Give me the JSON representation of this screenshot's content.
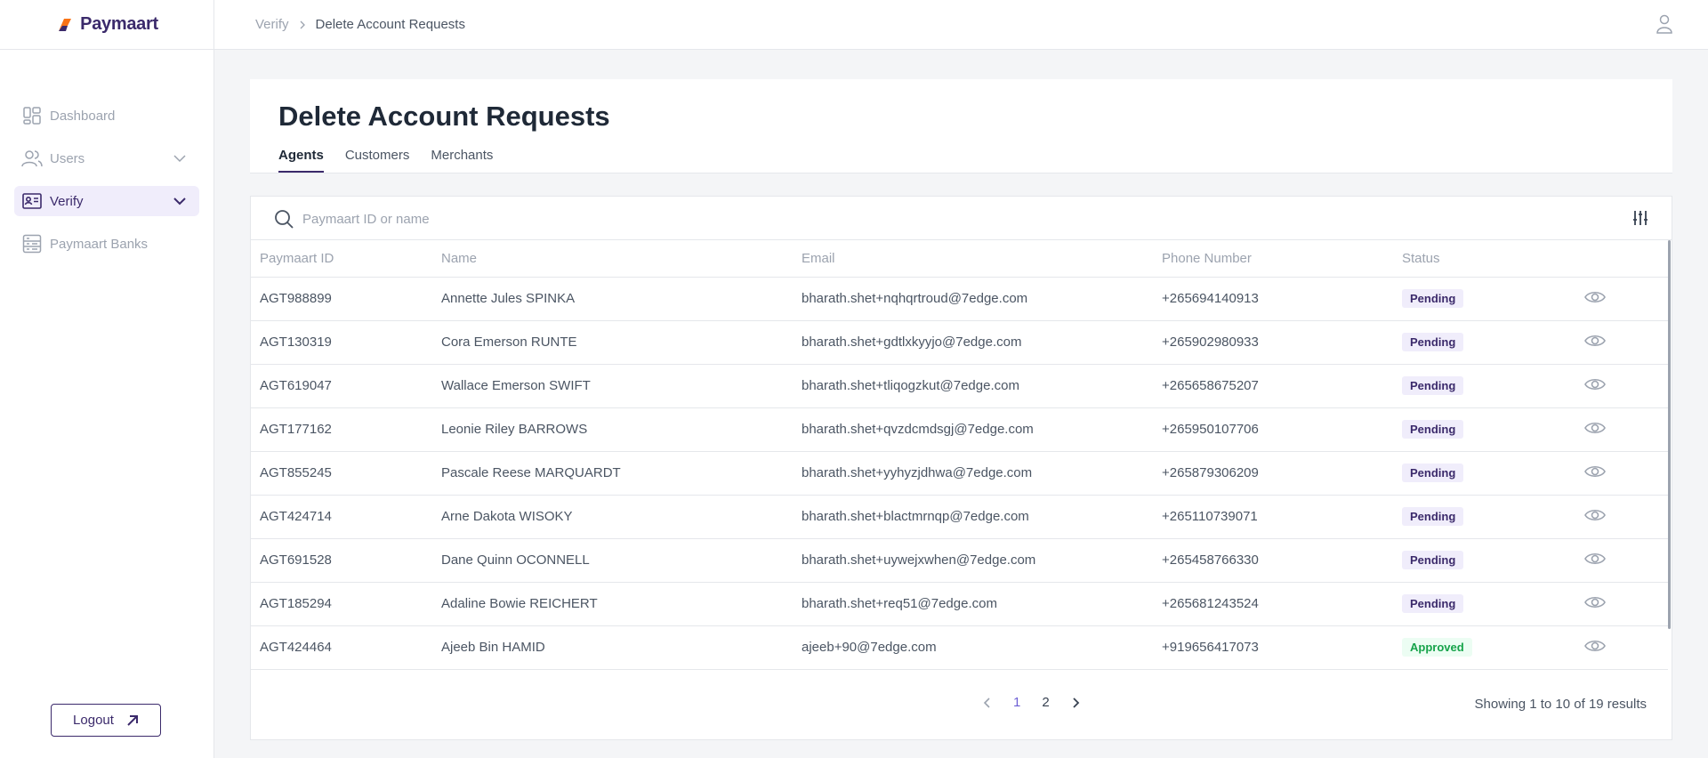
{
  "brand": {
    "name": "Paymaart"
  },
  "sidebar": {
    "items": [
      {
        "label": "Dashboard",
        "icon": "dashboard-icon"
      },
      {
        "label": "Users",
        "icon": "users-icon"
      },
      {
        "label": "Verify",
        "icon": "id-card-icon"
      },
      {
        "label": "Paymaart Banks",
        "icon": "bank-icon"
      }
    ],
    "logout_label": "Logout"
  },
  "breadcrumb": {
    "parent": "Verify",
    "current": "Delete Account Requests"
  },
  "page": {
    "title": "Delete Account Requests",
    "tabs": [
      {
        "label": "Agents",
        "active": true
      },
      {
        "label": "Customers",
        "active": false
      },
      {
        "label": "Merchants",
        "active": false
      }
    ]
  },
  "search": {
    "placeholder": "Paymaart ID or name"
  },
  "table": {
    "columns": [
      "Paymaart ID",
      "Name",
      "Email",
      "Phone Number",
      "Status"
    ],
    "rows": [
      {
        "id": "AGT988899",
        "name": "Annette Jules SPINKA",
        "email": "bharath.shet+nqhqrtroud@7edge.com",
        "phone": "+265694140913",
        "status": "Pending"
      },
      {
        "id": "AGT130319",
        "name": "Cora Emerson RUNTE",
        "email": "bharath.shet+gdtlxkyyjo@7edge.com",
        "phone": "+265902980933",
        "status": "Pending"
      },
      {
        "id": "AGT619047",
        "name": "Wallace Emerson SWIFT",
        "email": "bharath.shet+tliqogzkut@7edge.com",
        "phone": "+265658675207",
        "status": "Pending"
      },
      {
        "id": "AGT177162",
        "name": "Leonie Riley BARROWS",
        "email": "bharath.shet+qvzdcmdsgj@7edge.com",
        "phone": "+265950107706",
        "status": "Pending"
      },
      {
        "id": "AGT855245",
        "name": "Pascale Reese MARQUARDT",
        "email": "bharath.shet+yyhyzjdhwa@7edge.com",
        "phone": "+265879306209",
        "status": "Pending"
      },
      {
        "id": "AGT424714",
        "name": "Arne Dakota WISOKY",
        "email": "bharath.shet+blactmrnqp@7edge.com",
        "phone": "+265110739071",
        "status": "Pending"
      },
      {
        "id": "AGT691528",
        "name": "Dane Quinn OCONNELL",
        "email": "bharath.shet+uywejxwhen@7edge.com",
        "phone": "+265458766330",
        "status": "Pending"
      },
      {
        "id": "AGT185294",
        "name": "Adaline Bowie REICHERT",
        "email": "bharath.shet+req51@7edge.com",
        "phone": "+265681243524",
        "status": "Pending"
      },
      {
        "id": "AGT424464",
        "name": "Ajeeb Bin HAMID",
        "email": "ajeeb+90@7edge.com",
        "phone": "+919656417073",
        "status": "Approved"
      }
    ]
  },
  "pagination": {
    "pages": [
      "1",
      "2"
    ],
    "current": "1",
    "summary": "Showing 1 to 10 of 19 results"
  },
  "colors": {
    "brand": "#3b2a6b",
    "accent_orange": "#f97316",
    "pending_bg": "#f0edfb",
    "approved": "#16a34a"
  }
}
